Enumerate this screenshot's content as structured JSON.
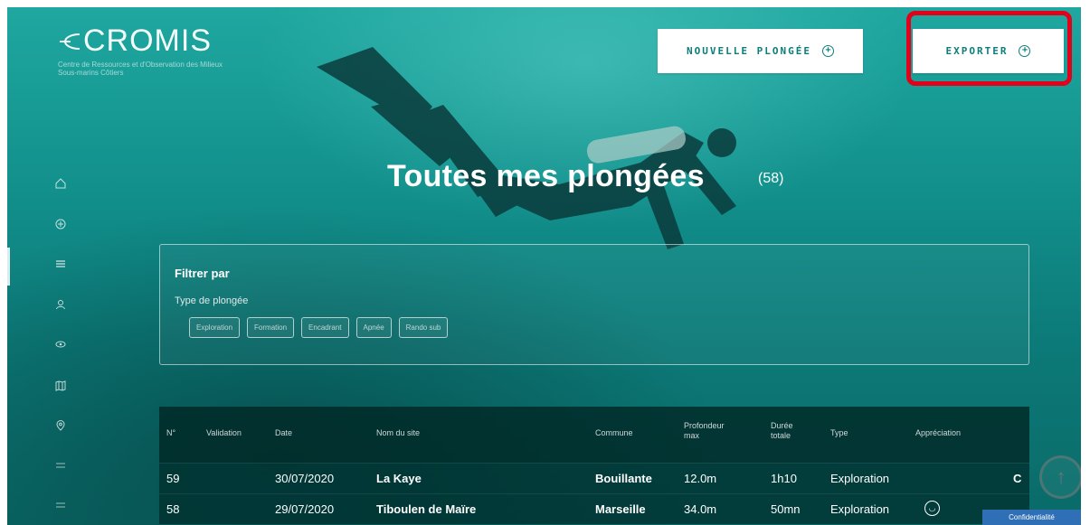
{
  "logo": {
    "name": "CROMIS",
    "tagline": "Centre de Ressources et d'Observation des Milieux Sous-marins Côtiers"
  },
  "header": {
    "new_dive_label": "NOUVELLE PLONGÉE",
    "export_label": "EXPORTER"
  },
  "sidebar": {
    "items": [
      {
        "icon": "home-icon"
      },
      {
        "icon": "plus-circle-icon"
      },
      {
        "icon": "list-icon"
      },
      {
        "icon": "user-icon"
      },
      {
        "icon": "eye-icon"
      },
      {
        "icon": "map-icon"
      },
      {
        "icon": "location-icon"
      },
      {
        "icon": "menu-icon"
      },
      {
        "icon": "menu-icon"
      }
    ]
  },
  "page": {
    "title": "Toutes mes plongées",
    "count": "(58)"
  },
  "filter": {
    "title": "Filtrer par",
    "type_label": "Type de plongée",
    "chips": [
      "Exploration",
      "Formation",
      "Encadrant",
      "Apnée",
      "Rando sub"
    ]
  },
  "table": {
    "headers": {
      "num": "N°",
      "validation": "Validation",
      "date": "Date",
      "site": "Nom du site",
      "commune": "Commune",
      "depth": "Profondeur max",
      "duration": "Durée totale",
      "type": "Type",
      "rating": "Appréciation"
    },
    "rows": [
      {
        "num": "59",
        "date": "30/07/2020",
        "site": "La Kaye",
        "commune": "Bouillante",
        "depth": "12.0m",
        "duration": "1h10",
        "type": "Exploration",
        "extra": "C"
      },
      {
        "num": "58",
        "date": "29/07/2020",
        "site": "Tiboulen de Maïre",
        "commune": "Marseille",
        "depth": "34.0m",
        "duration": "50mn",
        "type": "Exploration"
      }
    ]
  },
  "privacy_label": "Confidentialité",
  "colors": {
    "accent": "#0d7d7a",
    "highlight": "#e3001b"
  }
}
